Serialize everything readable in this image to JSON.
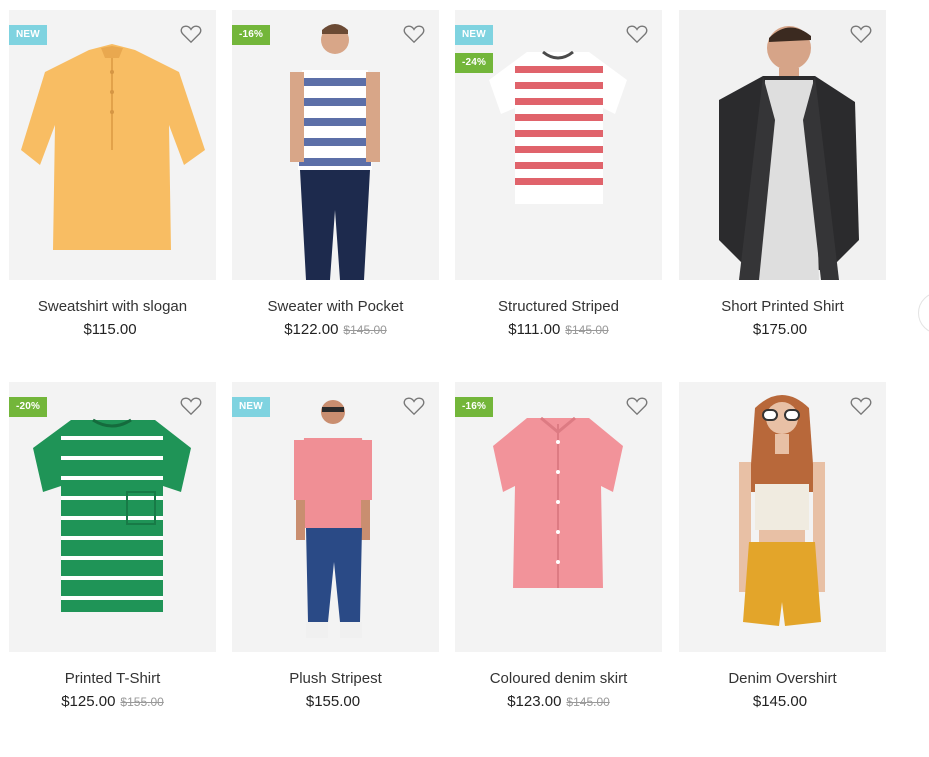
{
  "products": [
    {
      "title": "Sweatshirt with slogan",
      "price": "$115.00",
      "old_price": "",
      "badges": [
        {
          "text": "NEW",
          "kind": "new"
        }
      ]
    },
    {
      "title": "Sweater with Pocket",
      "price": "$122.00",
      "old_price": "$145.00",
      "badges": [
        {
          "text": "-16%",
          "kind": "sale"
        }
      ]
    },
    {
      "title": "Structured Striped",
      "price": "$111.00",
      "old_price": "$145.00",
      "badges": [
        {
          "text": "NEW",
          "kind": "new"
        },
        {
          "text": "-24%",
          "kind": "sale"
        }
      ]
    },
    {
      "title": "Short Printed Shirt",
      "price": "$175.00",
      "old_price": "",
      "badges": []
    },
    {
      "title": "Printed T-Shirt",
      "price": "$125.00",
      "old_price": "$155.00",
      "badges": [
        {
          "text": "-20%",
          "kind": "sale"
        }
      ]
    },
    {
      "title": "Plush Stripest",
      "price": "$155.00",
      "old_price": "",
      "badges": [
        {
          "text": "NEW",
          "kind": "new"
        }
      ]
    },
    {
      "title": "Coloured denim skirt",
      "price": "$123.00",
      "old_price": "$145.00",
      "badges": [
        {
          "text": "-16%",
          "kind": "sale"
        }
      ]
    },
    {
      "title": "Denim Overshirt",
      "price": "$145.00",
      "old_price": "",
      "badges": []
    }
  ],
  "colors": {
    "badge_new": "#7fd3e0",
    "badge_sale": "#73b63a",
    "image_bg": "#f3f3f3"
  },
  "icons": {
    "wishlist": "heart-outline-icon"
  }
}
